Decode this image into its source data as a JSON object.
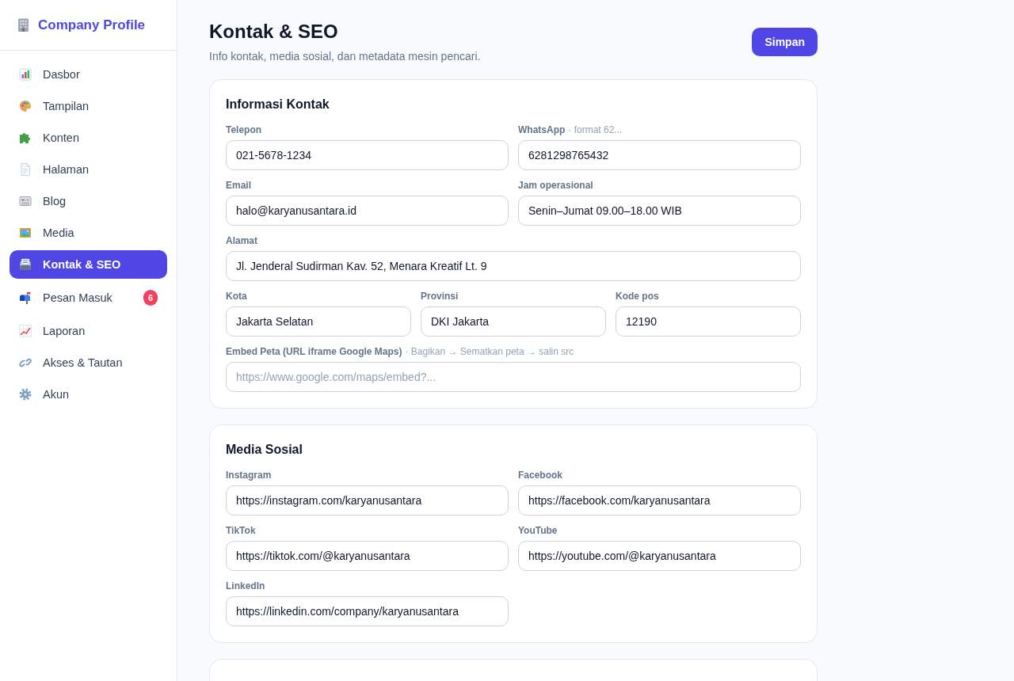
{
  "sidebar": {
    "brand": "Company Profile",
    "items": [
      {
        "label": "Dasbor",
        "selected": false
      },
      {
        "label": "Tampilan",
        "selected": false
      },
      {
        "label": "Konten",
        "selected": false
      },
      {
        "label": "Halaman",
        "selected": false
      },
      {
        "label": "Blog",
        "selected": false
      },
      {
        "label": "Media",
        "selected": false
      },
      {
        "label": "Kontak & SEO",
        "selected": true
      },
      {
        "label": "Pesan Masuk",
        "selected": false,
        "badge": "6"
      },
      {
        "label": "Laporan",
        "selected": false
      },
      {
        "label": "Akses & Tautan",
        "selected": false
      },
      {
        "label": "Akun",
        "selected": false
      }
    ]
  },
  "header": {
    "title": "Kontak & SEO",
    "subtitle": "Info kontak, media sosial, dan metadata mesin pencari.",
    "save_button": "Simpan"
  },
  "sections": [
    {
      "kind": "form",
      "title": "Informasi Kontak",
      "rows": [
        [
          {
            "label": "Telepon",
            "value": "021-5678-1234",
            "wide": false
          },
          {
            "label": "WhatsApp",
            "hint": "· format 62...",
            "value": "6281298765432",
            "wide": false
          }
        ],
        [
          {
            "label": "Email",
            "value": "halo@karyanusantara.id",
            "wide": false
          },
          {
            "label": "Jam operasional",
            "value": "Senin–Jumat 09.00–18.00 WIB",
            "wide": false
          }
        ],
        [
          {
            "label": "Alamat",
            "value": "Jl. Jenderal Sudirman Kav. 52, Menara Kreatif Lt. 9",
            "wide": true
          }
        ],
        [
          {
            "label": "Kota",
            "value": "Jakarta Selatan",
            "wide": false
          },
          {
            "label": "Provinsi",
            "value": "DKI Jakarta",
            "wide": false
          },
          {
            "label": "Kode pos",
            "value": "12190",
            "wide": false
          }
        ],
        [
          {
            "label": "Embed Peta (URL iframe Google Maps)",
            "hint": "· Bagikan → Sematkan peta → salin src",
            "placeholder": "https://www.google.com/maps/embed?...",
            "wide": true
          }
        ]
      ]
    },
    {
      "kind": "form",
      "title": "Media Sosial",
      "rows": [
        [
          {
            "label": "Instagram",
            "value": "https://instagram.com/karyanusantara",
            "wide": false
          },
          {
            "label": "Facebook",
            "value": "https://facebook.com/karyanusantara",
            "wide": false
          }
        ],
        [
          {
            "label": "TikTok",
            "value": "https://tiktok.com/@karyanusantara",
            "wide": false
          },
          {
            "label": "YouTube",
            "value": "https://youtube.com/@karyanusantara",
            "wide": false
          }
        ],
        [
          {
            "label": "LinkedIn",
            "value": "https://linkedin.com/company/karyanusantara",
            "wide": false
          }
        ]
      ]
    },
    {
      "kind": "cut_off"
    }
  ]
}
